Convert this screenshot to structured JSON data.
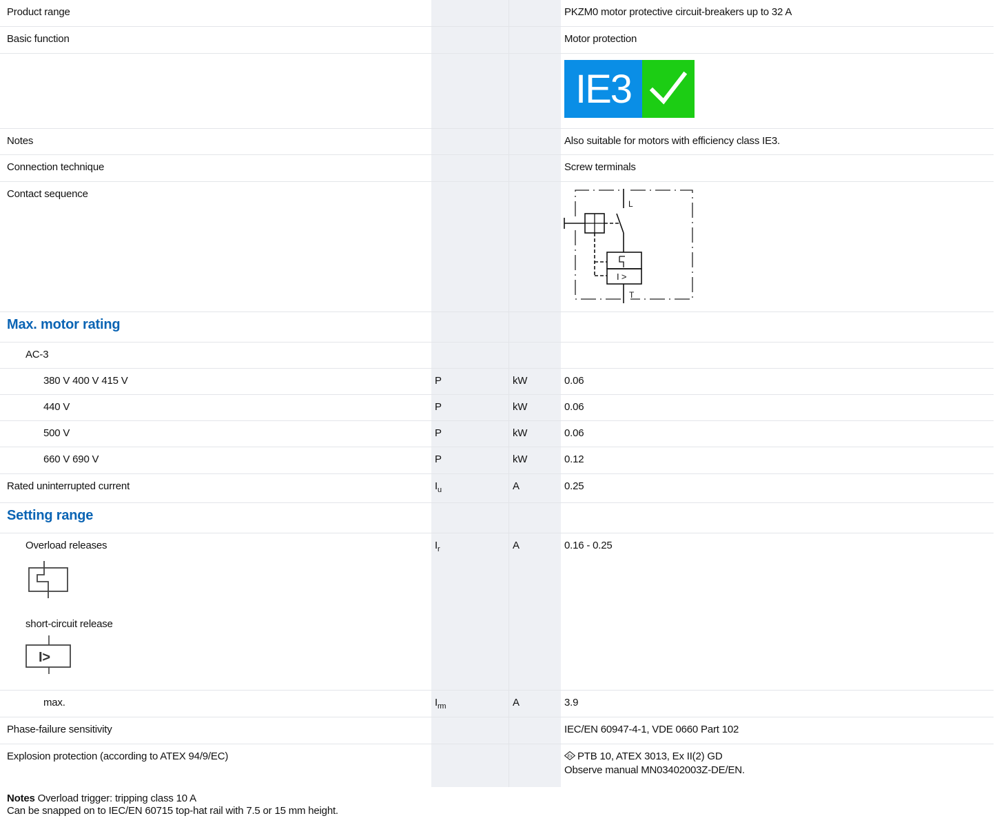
{
  "rows": {
    "product_range": {
      "label": "Product range",
      "value": "PKZM0 motor protective circuit-breakers up to 32 A"
    },
    "basic_function": {
      "label": "Basic function",
      "value": "Motor protection"
    },
    "ie3_badge": {
      "text": "IE3",
      "check_icon": "check-icon",
      "colors": {
        "left": "#0a8ee6",
        "right": "#1ccd14"
      }
    },
    "notes": {
      "label": "Notes",
      "value": "Also suitable for motors with efficiency class IE3."
    },
    "connection": {
      "label": "Connection technique",
      "value": "Screw terminals"
    },
    "contact_sequence": {
      "label": "Contact sequence",
      "diagram_labels": {
        "top": "L",
        "bottom": "T",
        "release": "I >"
      }
    },
    "max_motor_rating": {
      "heading": "Max. motor rating"
    },
    "ac3": {
      "label": "AC-3"
    },
    "v380": {
      "label": "380 V 400 V 415 V",
      "symbol": "P",
      "unit": "kW",
      "value": "0.06"
    },
    "v440": {
      "label": "440 V",
      "symbol": "P",
      "unit": "kW",
      "value": "0.06"
    },
    "v500": {
      "label": "500 V",
      "symbol": "P",
      "unit": "kW",
      "value": "0.06"
    },
    "v660": {
      "label": "660 V 690 V",
      "symbol": "P",
      "unit": "kW",
      "value": "0.12"
    },
    "rated_current": {
      "label": "Rated uninterrupted current",
      "symbol": "I",
      "symbol_sub": "u",
      "unit": "A",
      "value": "0.25"
    },
    "setting_range": {
      "heading": "Setting range"
    },
    "overload": {
      "label": "Overload releases",
      "symbol": "I",
      "symbol_sub": "r",
      "unit": "A",
      "value": "0.16 - 0.25"
    },
    "short_circuit": {
      "label": "short-circuit release",
      "icon_text": "I>"
    },
    "max": {
      "label": "max.",
      "symbol": "I",
      "symbol_sub": "rm",
      "unit": "A",
      "value": "3.9"
    },
    "phase_failure": {
      "label": "Phase-failure sensitivity",
      "value": "IEC/EN 60947-4-1, VDE 0660 Part 102"
    },
    "explosion": {
      "label": "Explosion protection (according to ATEX 94/9/EC)",
      "value_line1": "PTB 10, ATEX 3013, Ex II(2) GD",
      "value_line2": "Observe manual MN03402003Z-DE/EN.",
      "ex_icon": "ex-icon",
      "ex_text": "Ex"
    }
  },
  "footer": {
    "notes_label": "Notes",
    "line1": "Overload trigger: tripping class 10 A",
    "line2": "Can be snapped on to IEC/EN 60715 top-hat rail with 7.5 or 15 mm height."
  },
  "colors": {
    "heading": "#0a64b4",
    "column_shade": "#eef0f4"
  }
}
